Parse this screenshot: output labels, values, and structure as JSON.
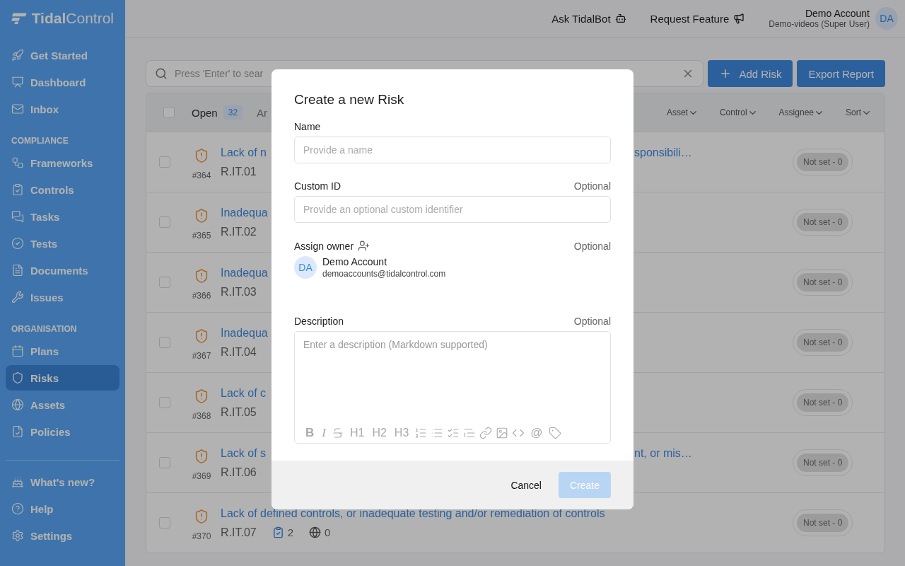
{
  "sidebar": {
    "logo": {
      "bold": "Tidal",
      "light": "Control"
    },
    "sections": [
      {
        "items": [
          {
            "label": "Get Started",
            "selected": false
          },
          {
            "label": "Dashboard",
            "selected": false
          },
          {
            "label": "Inbox",
            "selected": false
          }
        ]
      },
      {
        "heading": "COMPLIANCE",
        "items": [
          {
            "label": "Frameworks",
            "selected": false
          },
          {
            "label": "Controls",
            "selected": false
          },
          {
            "label": "Tasks",
            "selected": false
          },
          {
            "label": "Tests",
            "selected": false
          },
          {
            "label": "Documents",
            "selected": false
          },
          {
            "label": "Issues",
            "selected": false
          }
        ]
      },
      {
        "heading": "ORGANISATION",
        "items": [
          {
            "label": "Plans",
            "selected": false
          },
          {
            "label": "Risks",
            "selected": true
          },
          {
            "label": "Assets",
            "selected": false
          },
          {
            "label": "Policies",
            "selected": false
          }
        ]
      },
      {
        "divider": true,
        "items": [
          {
            "label": "What's new?",
            "selected": false
          },
          {
            "label": "Help",
            "selected": false
          },
          {
            "label": "Settings",
            "selected": false
          }
        ]
      }
    ]
  },
  "topbar": {
    "links": [
      "Ask TidalBot",
      "Request Feature"
    ],
    "user": {
      "name": "Demo Account",
      "role": "Demo-videos (Super User)",
      "initials": "DA"
    }
  },
  "search": {
    "placeholder": "Press 'Enter' to sear"
  },
  "actions": {
    "add": "Add Risk",
    "export": "Export Report"
  },
  "table": {
    "header_checked": false,
    "tabs": [
      {
        "label": "Open",
        "count": "32",
        "selected": true
      },
      {
        "label": "Ar",
        "selected": false
      }
    ],
    "filters": [
      "Asset",
      "Control",
      "Assignee",
      "Sort"
    ],
    "rows": [
      {
        "id": "#364",
        "code": "R.IT.01",
        "checked": false,
        "title_start": "Lack of n",
        "title_end": "sponsibili…",
        "badge": "Not set - 0"
      },
      {
        "id": "#365",
        "code": "R.IT.02",
        "checked": false,
        "title_start": "Inadequa",
        "badge": "Not set - 0"
      },
      {
        "id": "#366",
        "code": "R.IT.03",
        "checked": false,
        "title_start": "Inadequa",
        "badge": "Not set - 0"
      },
      {
        "id": "#367",
        "code": "R.IT.04",
        "checked": false,
        "title_start": "Inadequa",
        "badge": "Not set - 0"
      },
      {
        "id": "#368",
        "code": "R.IT.05",
        "checked": false,
        "title_start": "Lack of c",
        "badge": "Not set - 0"
      },
      {
        "id": "#369",
        "code": "R.IT.06",
        "checked": false,
        "title_start": "Lack of s",
        "title_end": "nt, or mis…",
        "badge": "Not set - 0"
      },
      {
        "id": "#370",
        "code": "R.IT.07",
        "checked": false,
        "title": "Lack of defined controls, or inadequate testing and/or remediation of controls",
        "controls": "2",
        "assets": "0",
        "badge": "Not set - 0"
      }
    ]
  },
  "modal": {
    "title": "Create a new Risk",
    "name": {
      "label": "Name",
      "placeholder": "Provide a name"
    },
    "custom_id": {
      "label": "Custom ID",
      "hint": "Optional",
      "placeholder": "Provide an optional custom identifier"
    },
    "owner": {
      "label": "Assign owner",
      "hint": "Optional",
      "initials": "DA",
      "name": "Demo Account",
      "email": "demoaccounts@tidalcontrol.com"
    },
    "description": {
      "label": "Description",
      "hint": "Optional",
      "placeholder": "Enter a description (Markdown supported)",
      "toolbar": [
        {
          "kind": "bold",
          "label": "B"
        },
        {
          "kind": "italic",
          "label": "I"
        },
        {
          "kind": "strike"
        },
        {
          "kind": "heading",
          "label": "H1"
        },
        {
          "kind": "heading",
          "label": "H2"
        },
        {
          "kind": "heading",
          "label": "H3"
        },
        {
          "kind": "ordered-list"
        },
        {
          "kind": "bullet-list"
        },
        {
          "kind": "task-list"
        },
        {
          "kind": "quote"
        },
        {
          "kind": "link"
        },
        {
          "kind": "image"
        },
        {
          "kind": "code"
        },
        {
          "kind": "mention",
          "label": "@"
        },
        {
          "kind": "tag"
        }
      ]
    },
    "cancel": "Cancel",
    "create": {
      "label": "Create",
      "disabled": true
    }
  }
}
